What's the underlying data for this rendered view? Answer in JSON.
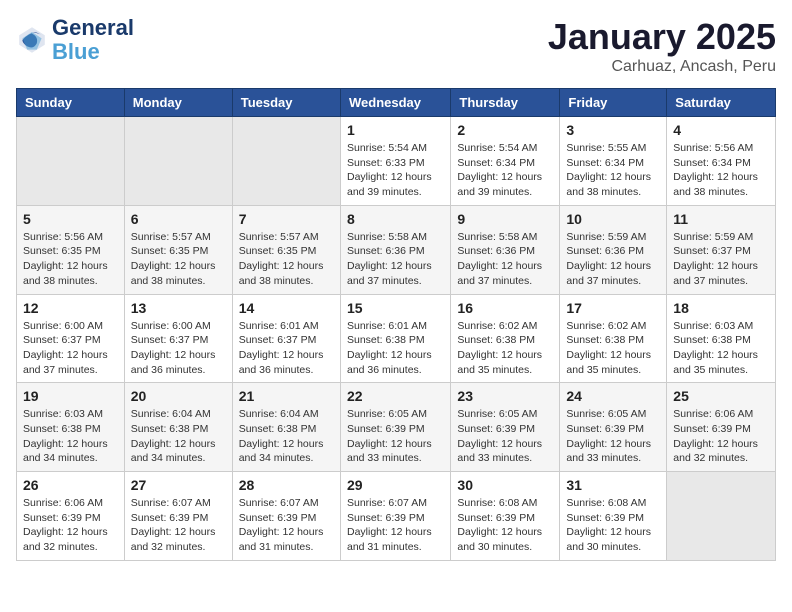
{
  "header": {
    "logo_line1": "General",
    "logo_line2": "Blue",
    "month": "January 2025",
    "location": "Carhuaz, Ancash, Peru"
  },
  "weekdays": [
    "Sunday",
    "Monday",
    "Tuesday",
    "Wednesday",
    "Thursday",
    "Friday",
    "Saturday"
  ],
  "weeks": [
    [
      {
        "day": "",
        "info": ""
      },
      {
        "day": "",
        "info": ""
      },
      {
        "day": "",
        "info": ""
      },
      {
        "day": "1",
        "info": "Sunrise: 5:54 AM\nSunset: 6:33 PM\nDaylight: 12 hours\nand 39 minutes."
      },
      {
        "day": "2",
        "info": "Sunrise: 5:54 AM\nSunset: 6:34 PM\nDaylight: 12 hours\nand 39 minutes."
      },
      {
        "day": "3",
        "info": "Sunrise: 5:55 AM\nSunset: 6:34 PM\nDaylight: 12 hours\nand 38 minutes."
      },
      {
        "day": "4",
        "info": "Sunrise: 5:56 AM\nSunset: 6:34 PM\nDaylight: 12 hours\nand 38 minutes."
      }
    ],
    [
      {
        "day": "5",
        "info": "Sunrise: 5:56 AM\nSunset: 6:35 PM\nDaylight: 12 hours\nand 38 minutes."
      },
      {
        "day": "6",
        "info": "Sunrise: 5:57 AM\nSunset: 6:35 PM\nDaylight: 12 hours\nand 38 minutes."
      },
      {
        "day": "7",
        "info": "Sunrise: 5:57 AM\nSunset: 6:35 PM\nDaylight: 12 hours\nand 38 minutes."
      },
      {
        "day": "8",
        "info": "Sunrise: 5:58 AM\nSunset: 6:36 PM\nDaylight: 12 hours\nand 37 minutes."
      },
      {
        "day": "9",
        "info": "Sunrise: 5:58 AM\nSunset: 6:36 PM\nDaylight: 12 hours\nand 37 minutes."
      },
      {
        "day": "10",
        "info": "Sunrise: 5:59 AM\nSunset: 6:36 PM\nDaylight: 12 hours\nand 37 minutes."
      },
      {
        "day": "11",
        "info": "Sunrise: 5:59 AM\nSunset: 6:37 PM\nDaylight: 12 hours\nand 37 minutes."
      }
    ],
    [
      {
        "day": "12",
        "info": "Sunrise: 6:00 AM\nSunset: 6:37 PM\nDaylight: 12 hours\nand 37 minutes."
      },
      {
        "day": "13",
        "info": "Sunrise: 6:00 AM\nSunset: 6:37 PM\nDaylight: 12 hours\nand 36 minutes."
      },
      {
        "day": "14",
        "info": "Sunrise: 6:01 AM\nSunset: 6:37 PM\nDaylight: 12 hours\nand 36 minutes."
      },
      {
        "day": "15",
        "info": "Sunrise: 6:01 AM\nSunset: 6:38 PM\nDaylight: 12 hours\nand 36 minutes."
      },
      {
        "day": "16",
        "info": "Sunrise: 6:02 AM\nSunset: 6:38 PM\nDaylight: 12 hours\nand 35 minutes."
      },
      {
        "day": "17",
        "info": "Sunrise: 6:02 AM\nSunset: 6:38 PM\nDaylight: 12 hours\nand 35 minutes."
      },
      {
        "day": "18",
        "info": "Sunrise: 6:03 AM\nSunset: 6:38 PM\nDaylight: 12 hours\nand 35 minutes."
      }
    ],
    [
      {
        "day": "19",
        "info": "Sunrise: 6:03 AM\nSunset: 6:38 PM\nDaylight: 12 hours\nand 34 minutes."
      },
      {
        "day": "20",
        "info": "Sunrise: 6:04 AM\nSunset: 6:38 PM\nDaylight: 12 hours\nand 34 minutes."
      },
      {
        "day": "21",
        "info": "Sunrise: 6:04 AM\nSunset: 6:38 PM\nDaylight: 12 hours\nand 34 minutes."
      },
      {
        "day": "22",
        "info": "Sunrise: 6:05 AM\nSunset: 6:39 PM\nDaylight: 12 hours\nand 33 minutes."
      },
      {
        "day": "23",
        "info": "Sunrise: 6:05 AM\nSunset: 6:39 PM\nDaylight: 12 hours\nand 33 minutes."
      },
      {
        "day": "24",
        "info": "Sunrise: 6:05 AM\nSunset: 6:39 PM\nDaylight: 12 hours\nand 33 minutes."
      },
      {
        "day": "25",
        "info": "Sunrise: 6:06 AM\nSunset: 6:39 PM\nDaylight: 12 hours\nand 32 minutes."
      }
    ],
    [
      {
        "day": "26",
        "info": "Sunrise: 6:06 AM\nSunset: 6:39 PM\nDaylight: 12 hours\nand 32 minutes."
      },
      {
        "day": "27",
        "info": "Sunrise: 6:07 AM\nSunset: 6:39 PM\nDaylight: 12 hours\nand 32 minutes."
      },
      {
        "day": "28",
        "info": "Sunrise: 6:07 AM\nSunset: 6:39 PM\nDaylight: 12 hours\nand 31 minutes."
      },
      {
        "day": "29",
        "info": "Sunrise: 6:07 AM\nSunset: 6:39 PM\nDaylight: 12 hours\nand 31 minutes."
      },
      {
        "day": "30",
        "info": "Sunrise: 6:08 AM\nSunset: 6:39 PM\nDaylight: 12 hours\nand 30 minutes."
      },
      {
        "day": "31",
        "info": "Sunrise: 6:08 AM\nSunset: 6:39 PM\nDaylight: 12 hours\nand 30 minutes."
      },
      {
        "day": "",
        "info": ""
      }
    ]
  ]
}
